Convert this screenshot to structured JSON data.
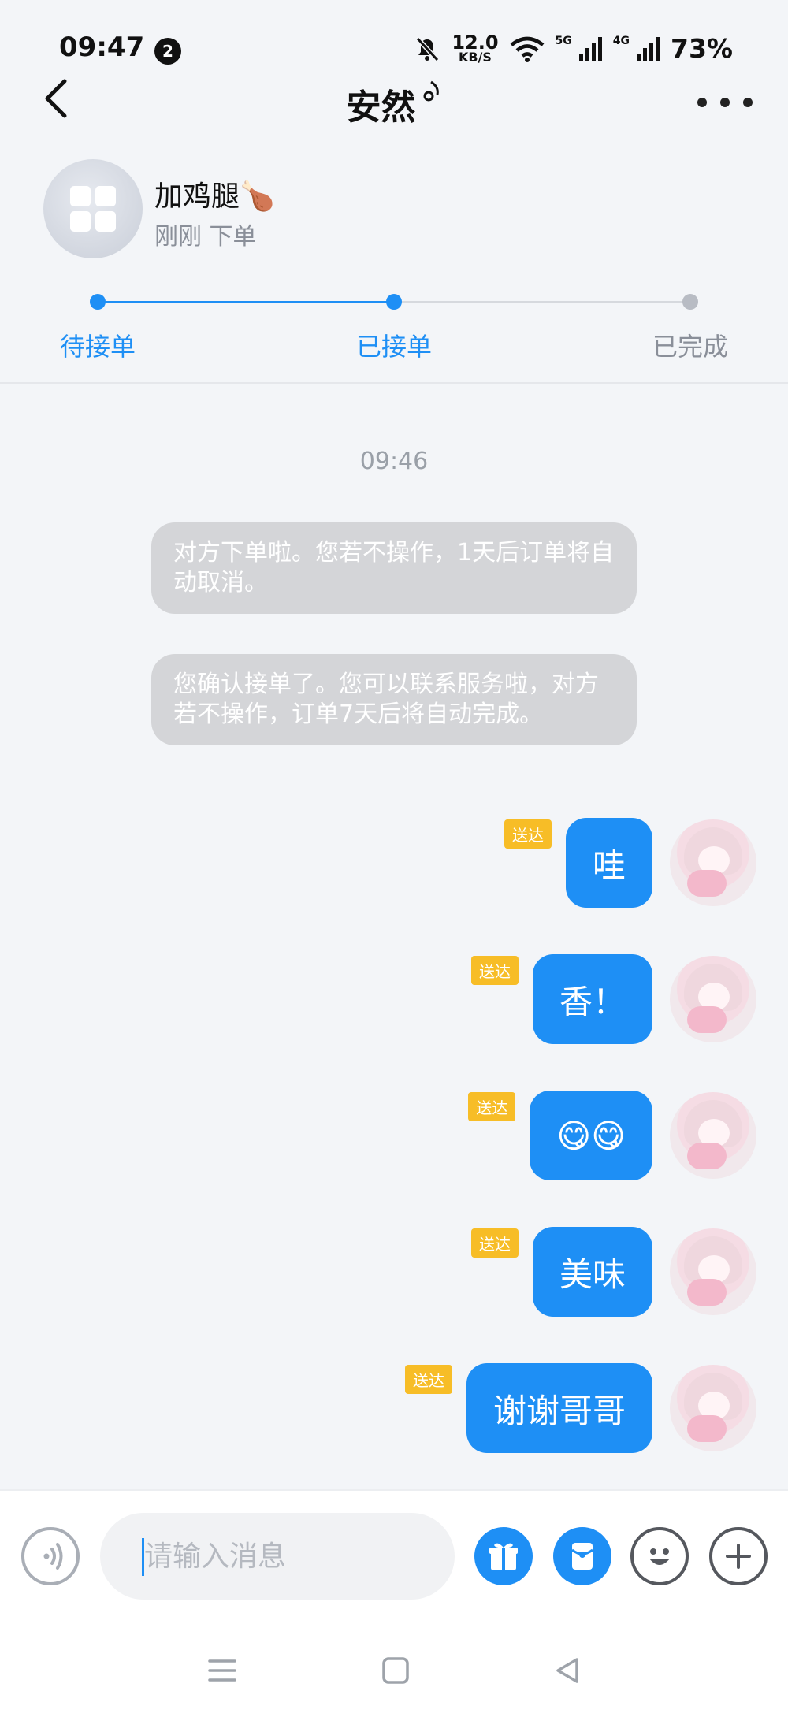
{
  "status_bar": {
    "time": "09:47",
    "notification_count": "2",
    "net_speed_value": "12.0",
    "net_speed_unit": "KB/S",
    "signal_1_label": "5G",
    "signal_2_label": "4G",
    "battery": "73%"
  },
  "header": {
    "title": "安然",
    "back_icon": "chevron-left-icon",
    "more_icon": "more-horizontal-icon"
  },
  "order": {
    "name": "加鸡腿🍗",
    "status_text": "刚刚 下单"
  },
  "progress": {
    "steps": [
      {
        "label": "待接单",
        "state": "done"
      },
      {
        "label": "已接单",
        "state": "current"
      },
      {
        "label": "已完成",
        "state": "pending"
      }
    ],
    "active_color": "#1e8ff5",
    "inactive_color": "#b8bcc4"
  },
  "chat": {
    "timestamp": "09:46",
    "system_messages": [
      "对方下单啦。您若不操作，1天后订单将自动取消。",
      "您确认接单了。您可以联系服务啦，对方若不操作，订单7天后将自动完成。"
    ],
    "messages": [
      {
        "text": "哇",
        "badge": "送达"
      },
      {
        "text": "香！",
        "badge": "送达"
      },
      {
        "text": "😋😋",
        "badge": "送达"
      },
      {
        "text": "美味",
        "badge": "送达"
      },
      {
        "text": "谢谢哥哥",
        "badge": "送达"
      }
    ]
  },
  "composer": {
    "placeholder": "请输入消息",
    "voice_icon": "voice-icon",
    "gift_icon": "gift-icon",
    "red_packet_icon": "red-packet-icon",
    "emoji_icon": "emoji-icon",
    "add_icon": "plus-icon"
  },
  "colors": {
    "accent": "#1e8ff5",
    "badge": "#f7bd27",
    "system_bubble": "#d4d5d8"
  }
}
